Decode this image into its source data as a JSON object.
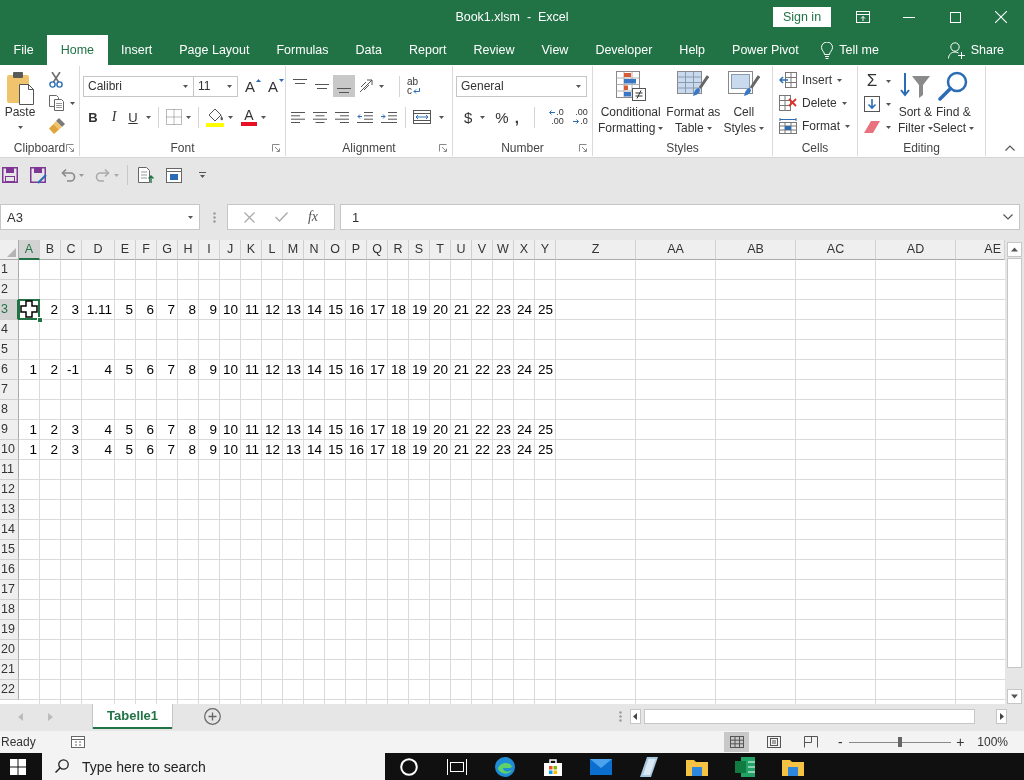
{
  "title_bar": {
    "title": "Book1.xlsm  -  Excel",
    "sign_in": "Sign in"
  },
  "ribbon_tabs": [
    {
      "label": "File",
      "selected": false
    },
    {
      "label": "Home",
      "selected": true
    },
    {
      "label": "Insert",
      "selected": false
    },
    {
      "label": "Page Layout",
      "selected": false
    },
    {
      "label": "Formulas",
      "selected": false
    },
    {
      "label": "Data",
      "selected": false
    },
    {
      "label": "Report",
      "selected": false
    },
    {
      "label": "Review",
      "selected": false
    },
    {
      "label": "View",
      "selected": false
    },
    {
      "label": "Developer",
      "selected": false
    },
    {
      "label": "Help",
      "selected": false
    },
    {
      "label": "Power Pivot",
      "selected": false
    }
  ],
  "tell_me": "Tell me",
  "share": "Share",
  "ribbon": {
    "clipboard": {
      "label": "Clipboard",
      "paste": "Paste"
    },
    "font": {
      "label": "Font",
      "font_name": "Calibri",
      "font_size": "11",
      "grow": "A",
      "shrink": "A",
      "bold": "B",
      "italic": "I",
      "underline": "U",
      "font_color": "A"
    },
    "alignment": {
      "label": "Alignment",
      "vertical": [
        {
          "selected": false
        },
        {
          "selected": false
        },
        {
          "selected": true
        }
      ],
      "wrap_text": [
        "ab",
        "c"
      ]
    },
    "number": {
      "label": "Number",
      "format": "General",
      "currency": "$",
      "percent": "%",
      "comma": ",",
      "increase_decimal": [
        ".0",
        ".00"
      ],
      "decrease_decimal": [
        ".00",
        ".0"
      ]
    },
    "styles": {
      "label": "Styles",
      "buttons": [
        {
          "lines": [
            "Conditional",
            "Formatting"
          ]
        },
        {
          "lines": [
            "Format as",
            "Table"
          ]
        },
        {
          "lines": [
            "Cell",
            "Styles"
          ]
        }
      ]
    },
    "cells": {
      "label": "Cells",
      "buttons": [
        "Insert",
        "Delete",
        "Format"
      ]
    },
    "editing": {
      "label": "Editing",
      "autosum": "Σ",
      "buttons": [
        {
          "lines": [
            "Sort &",
            "Filter"
          ]
        },
        {
          "lines": [
            "Find &",
            "Select"
          ]
        }
      ]
    }
  },
  "formula_bar": {
    "name_box": "A3",
    "function_button": "fx",
    "formula": "1"
  },
  "sheet": {
    "columns": [
      {
        "label": "A",
        "selected": true
      },
      {
        "label": "B",
        "selected": false
      },
      {
        "label": "C",
        "selected": false
      },
      {
        "label": "D",
        "selected": false
      },
      {
        "label": "E",
        "selected": false
      },
      {
        "label": "F",
        "selected": false
      },
      {
        "label": "G",
        "selected": false
      },
      {
        "label": "H",
        "selected": false
      },
      {
        "label": "I",
        "selected": false
      },
      {
        "label": "J",
        "selected": false
      },
      {
        "label": "K",
        "selected": false
      },
      {
        "label": "L",
        "selected": false
      },
      {
        "label": "M",
        "selected": false
      },
      {
        "label": "N",
        "selected": false
      },
      {
        "label": "O",
        "selected": false
      },
      {
        "label": "P",
        "selected": false
      },
      {
        "label": "Q",
        "selected": false
      },
      {
        "label": "R",
        "selected": false
      },
      {
        "label": "S",
        "selected": false
      },
      {
        "label": "T",
        "selected": false
      },
      {
        "label": "U",
        "selected": false
      },
      {
        "label": "V",
        "selected": false
      },
      {
        "label": "W",
        "selected": false
      },
      {
        "label": "X",
        "selected": false
      },
      {
        "label": "Y",
        "selected": false
      },
      {
        "label": "Z",
        "selected": false
      },
      {
        "label": "AA",
        "selected": false
      },
      {
        "label": "AB",
        "selected": false
      },
      {
        "label": "AC",
        "selected": false
      },
      {
        "label": "AD",
        "selected": false
      },
      {
        "label": "AE",
        "selected": false
      }
    ],
    "rows": [
      {
        "label": "1",
        "selected": false
      },
      {
        "label": "2",
        "selected": false
      },
      {
        "label": "3",
        "selected": true,
        "cells": [
          null,
          "2",
          "3",
          "1.11",
          "5",
          "6",
          "7",
          "8",
          "9",
          "10",
          "11",
          "12",
          "13",
          "14",
          "15",
          "16",
          "17",
          "18",
          "19",
          "20",
          "21",
          "22",
          "23",
          "24",
          "25"
        ]
      },
      {
        "label": "4",
        "selected": false
      },
      {
        "label": "5",
        "selected": false
      },
      {
        "label": "6",
        "selected": false,
        "cells": [
          "1",
          "2",
          "-1",
          "4",
          "5",
          "6",
          "7",
          "8",
          "9",
          "10",
          "11",
          "12",
          "13",
          "14",
          "15",
          "16",
          "17",
          "18",
          "19",
          "20",
          "21",
          "22",
          "23",
          "24",
          "25"
        ]
      },
      {
        "label": "7",
        "selected": false
      },
      {
        "label": "8",
        "selected": false
      },
      {
        "label": "9",
        "selected": false,
        "cells": [
          "1",
          "2",
          "3",
          "4",
          "5",
          "6",
          "7",
          "8",
          "9",
          "10",
          "11",
          "12",
          "13",
          "14",
          "15",
          "16",
          "17",
          "18",
          "19",
          "20",
          "21",
          "22",
          "23",
          "24",
          "25"
        ]
      },
      {
        "label": "10",
        "selected": false,
        "cells": [
          "1",
          "2",
          "3",
          "4",
          "5",
          "6",
          "7",
          "8",
          "9",
          "10",
          "11",
          "12",
          "13",
          "14",
          "15",
          "16",
          "17",
          "18",
          "19",
          "20",
          "21",
          "22",
          "23",
          "24",
          "25"
        ]
      },
      {
        "label": "11",
        "selected": false
      },
      {
        "label": "12",
        "selected": false
      },
      {
        "label": "13",
        "selected": false
      },
      {
        "label": "14",
        "selected": false
      },
      {
        "label": "15",
        "selected": false
      },
      {
        "label": "16",
        "selected": false
      },
      {
        "label": "17",
        "selected": false
      },
      {
        "label": "18",
        "selected": false
      },
      {
        "label": "19",
        "selected": false
      },
      {
        "label": "20",
        "selected": false
      },
      {
        "label": "21",
        "selected": false
      },
      {
        "label": "22",
        "selected": false
      }
    ]
  },
  "sheet_tabs": [
    {
      "label": "Tabelle1",
      "selected": true
    }
  ],
  "status_bar": {
    "status": "Ready",
    "views": [
      {
        "selected": true
      },
      {
        "selected": false
      },
      {
        "selected": false
      }
    ],
    "zoom_out": "-",
    "zoom_slider": {
      "level": 0.5
    },
    "zoom_in": "+",
    "zoom": "100%"
  },
  "taskbar": {
    "search": {
      "placeholder": "Type here to search"
    }
  }
}
